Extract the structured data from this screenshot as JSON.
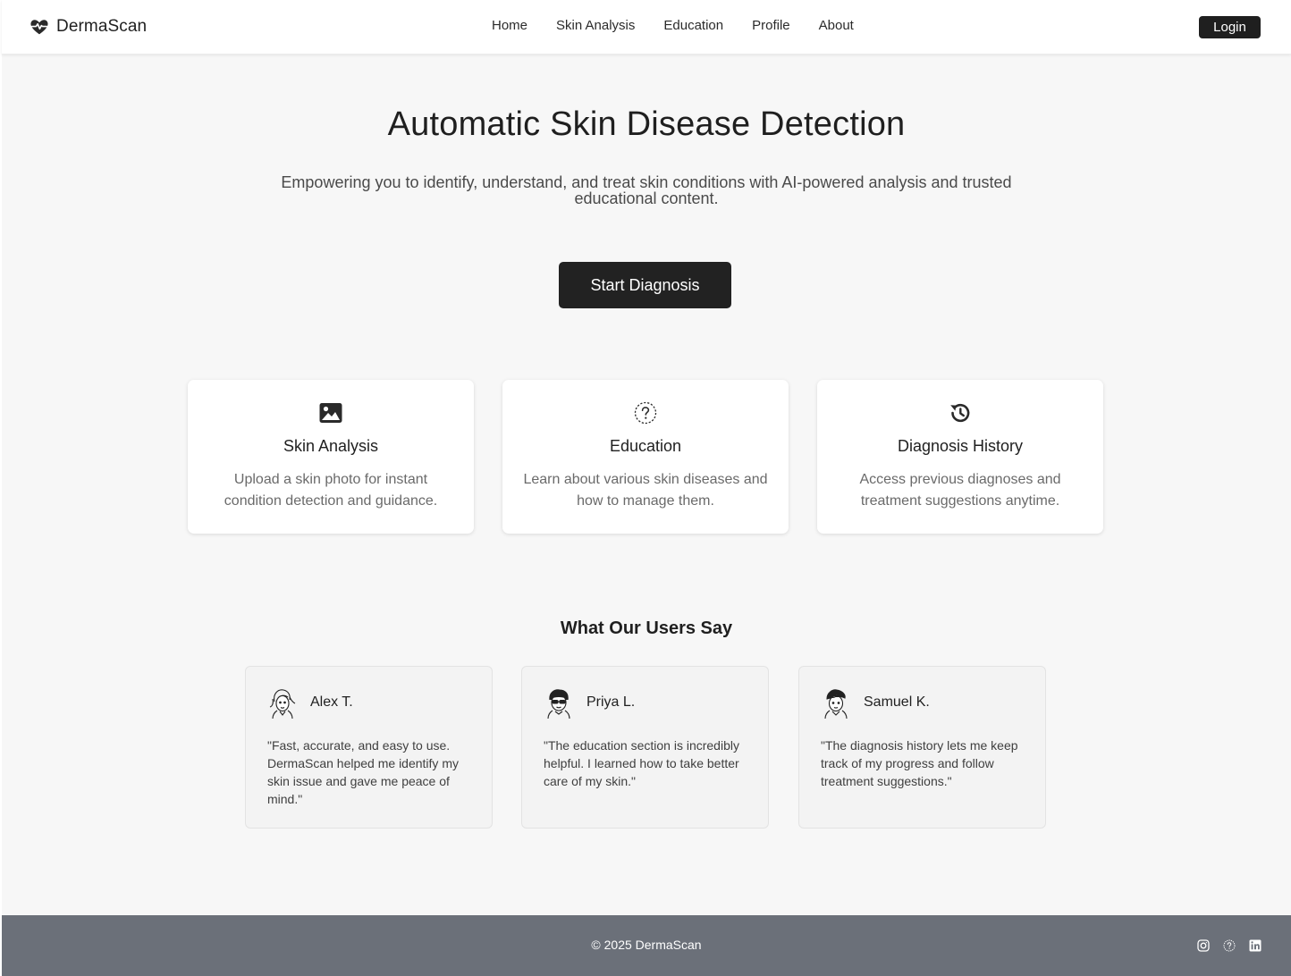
{
  "header": {
    "brand_name": "DermaScan",
    "brand_icon": "heart-pulse-icon",
    "nav": [
      "Home",
      "Skin Analysis",
      "Education",
      "Profile",
      "About"
    ],
    "login_label": "Login"
  },
  "hero": {
    "title": "Automatic Skin Disease Detection",
    "subtitle": "Empowering you to identify, understand, and treat skin conditions with AI-powered analysis and trusted educational content.",
    "cta_label": "Start Diagnosis"
  },
  "features": [
    {
      "icon": "image-icon",
      "title": "Skin Analysis",
      "description": "Upload a skin photo for instant condition detection and guidance."
    },
    {
      "icon": "question-circle-icon",
      "title": "Education",
      "description": "Learn about various skin diseases and how to manage them."
    },
    {
      "icon": "history-icon",
      "title": "Diagnosis History",
      "description": "Access previous diagnoses and treatment suggestions anytime."
    }
  ],
  "testimonials": {
    "title": "What Our Users Say",
    "items": [
      {
        "name": "Alex T.",
        "quote": "\"Fast, accurate, and easy to use. DermaScan helped me identify my skin issue and gave me peace of mind.\""
      },
      {
        "name": "Priya L.",
        "quote": "\"The education section is incredibly helpful. I learned how to take better care of my skin.\""
      },
      {
        "name": "Samuel K.",
        "quote": "\"The diagnosis history lets me keep track of my progress and follow treatment suggestions.\""
      }
    ]
  },
  "footer": {
    "copyright": "© 2025 DermaScan",
    "social_icons": [
      "instagram-icon",
      "help-icon",
      "linkedin-icon"
    ]
  },
  "colors": {
    "page_background": "#f7f7f7",
    "button_dark": "#222222",
    "footer_background": "#6b7079"
  }
}
